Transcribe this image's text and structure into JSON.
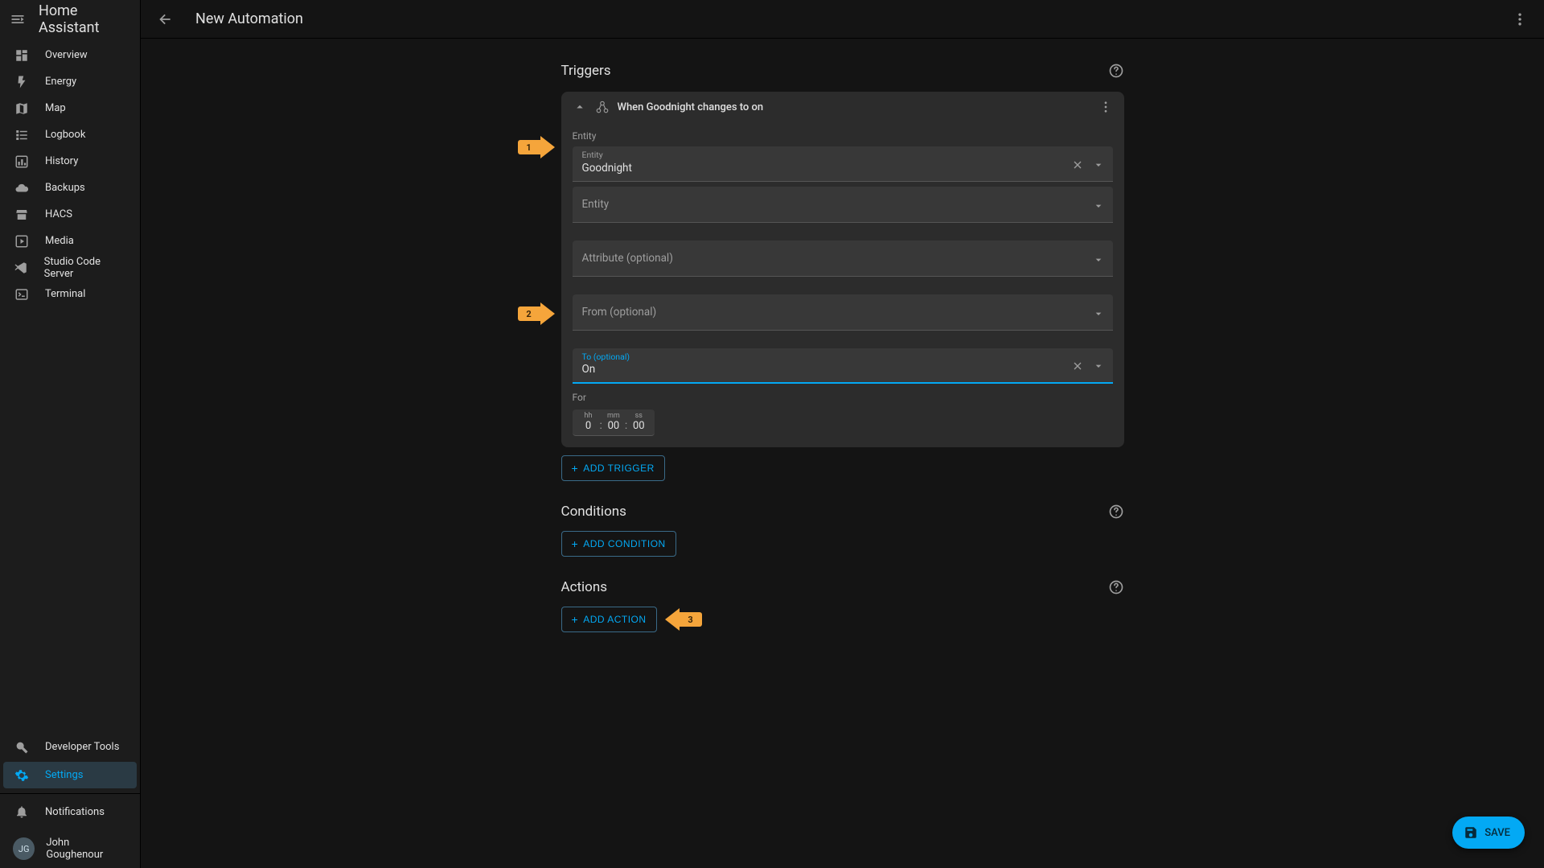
{
  "app_title": "Home Assistant",
  "page_title": "New Automation",
  "sidebar": {
    "items": [
      {
        "label": "Overview"
      },
      {
        "label": "Energy"
      },
      {
        "label": "Map"
      },
      {
        "label": "Logbook"
      },
      {
        "label": "History"
      },
      {
        "label": "Backups"
      },
      {
        "label": "HACS"
      },
      {
        "label": "Media"
      },
      {
        "label": "Studio Code Server"
      },
      {
        "label": "Terminal"
      }
    ],
    "bottom": {
      "dev_tools": "Developer Tools",
      "settings": "Settings",
      "notifications": "Notifications",
      "user_name": "John Goughenour",
      "user_initials": "JG"
    }
  },
  "triggers": {
    "title": "Triggers",
    "summary": "When Goodnight changes to on",
    "entity_section_label": "Entity",
    "entity_field_label": "Entity",
    "entity_value": "Goodnight",
    "entity2_placeholder": "Entity",
    "attribute_placeholder": "Attribute (optional)",
    "from_placeholder": "From (optional)",
    "to_label": "To (optional)",
    "to_value": "On",
    "for_label": "For",
    "for_hh_label": "hh",
    "for_hh_value": "0",
    "for_mm_label": "mm",
    "for_mm_value": "00",
    "for_ss_label": "ss",
    "for_ss_value": "00",
    "add_button": "ADD TRIGGER"
  },
  "conditions": {
    "title": "Conditions",
    "add_button": "ADD CONDITION"
  },
  "actions": {
    "title": "Actions",
    "add_button": "ADD ACTION"
  },
  "save_button": "SAVE",
  "annotations": {
    "a1": "1",
    "a2": "2",
    "a3": "3"
  }
}
